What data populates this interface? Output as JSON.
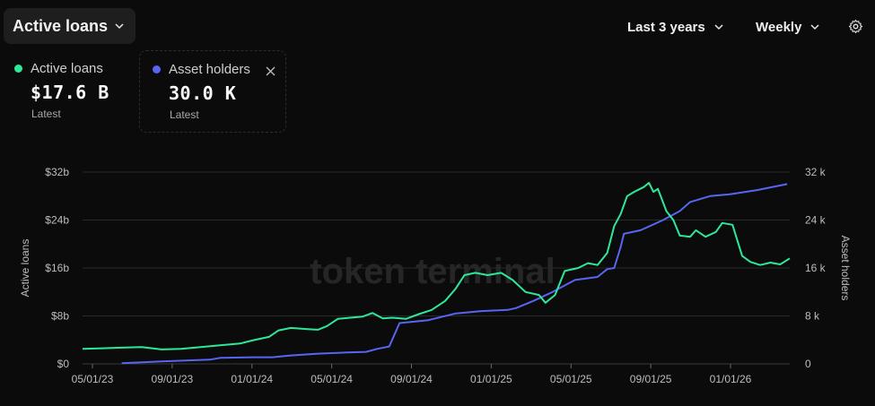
{
  "header": {
    "metric_label": "Active loans",
    "range_label": "Last 3 years",
    "interval_label": "Weekly"
  },
  "legend": [
    {
      "name": "Active loans",
      "value": "$17.6 B",
      "sub": "Latest",
      "color": "#2ee89a"
    },
    {
      "name": "Asset holders",
      "value": "30.0 K",
      "sub": "Latest",
      "color": "#5865f2"
    }
  ],
  "watermark": "token terminal",
  "chart_data": {
    "type": "line",
    "x_tick_labels": [
      "05/01/23",
      "09/01/23",
      "01/01/24",
      "05/01/24",
      "09/01/24",
      "01/01/25",
      "05/01/25",
      "09/01/25",
      "01/01/26"
    ],
    "y_left": {
      "label": "Active loans",
      "ticks": [
        "$0",
        "$8b",
        "$16b",
        "$24b",
        "$32b"
      ],
      "range": [
        0,
        32
      ]
    },
    "y_right": {
      "label": "Asset holders",
      "ticks": [
        "0",
        "8 k",
        "16 k",
        "24 k",
        "32 k"
      ],
      "range": [
        0,
        32
      ]
    },
    "grid": true,
    "series": [
      {
        "name": "Active loans",
        "axis": "left",
        "unit": "billion USD",
        "color": "#2ee89a",
        "points": [
          [
            "2023-05-01",
            2.5
          ],
          [
            "2023-06-01",
            2.6
          ],
          [
            "2023-07-01",
            2.7
          ],
          [
            "2023-08-01",
            2.8
          ],
          [
            "2023-09-01",
            2.4
          ],
          [
            "2023-10-01",
            2.5
          ],
          [
            "2023-11-01",
            2.8
          ],
          [
            "2023-12-01",
            3.1
          ],
          [
            "2024-01-01",
            3.4
          ],
          [
            "2024-01-20",
            3.9
          ],
          [
            "2024-02-15",
            4.5
          ],
          [
            "2024-03-01",
            5.6
          ],
          [
            "2024-03-20",
            6.0
          ],
          [
            "2024-04-15",
            5.8
          ],
          [
            "2024-05-01",
            5.7
          ],
          [
            "2024-05-15",
            6.3
          ],
          [
            "2024-06-01",
            7.5
          ],
          [
            "2024-06-20",
            7.7
          ],
          [
            "2024-07-10",
            7.9
          ],
          [
            "2024-07-25",
            8.5
          ],
          [
            "2024-08-10",
            7.6
          ],
          [
            "2024-08-25",
            7.7
          ],
          [
            "2024-09-15",
            7.5
          ],
          [
            "2024-10-05",
            8.3
          ],
          [
            "2024-10-25",
            9.0
          ],
          [
            "2024-11-15",
            10.5
          ],
          [
            "2024-12-01",
            12.5
          ],
          [
            "2024-12-15",
            14.8
          ],
          [
            "2025-01-01",
            15.2
          ],
          [
            "2025-01-20",
            14.8
          ],
          [
            "2025-02-10",
            15.2
          ],
          [
            "2025-02-28",
            14.0
          ],
          [
            "2025-03-20",
            12.0
          ],
          [
            "2025-04-10",
            11.5
          ],
          [
            "2025-04-20",
            10.2
          ],
          [
            "2025-05-05",
            11.5
          ],
          [
            "2025-05-20",
            15.5
          ],
          [
            "2025-06-10",
            16.0
          ],
          [
            "2025-06-25",
            16.8
          ],
          [
            "2025-07-10",
            16.5
          ],
          [
            "2025-07-25",
            18.5
          ],
          [
            "2025-08-05",
            23.0
          ],
          [
            "2025-08-15",
            25.0
          ],
          [
            "2025-08-25",
            28.0
          ],
          [
            "2025-09-05",
            28.7
          ],
          [
            "2025-09-20",
            29.5
          ],
          [
            "2025-09-28",
            30.2
          ],
          [
            "2025-10-05",
            28.7
          ],
          [
            "2025-10-12",
            29.2
          ],
          [
            "2025-10-25",
            25.5
          ],
          [
            "2025-11-05",
            24.0
          ],
          [
            "2025-11-15",
            21.4
          ],
          [
            "2025-12-01",
            21.2
          ],
          [
            "2025-12-10",
            22.3
          ],
          [
            "2025-12-25",
            21.2
          ],
          [
            "2026-01-10",
            22.0
          ],
          [
            "2026-01-20",
            23.5
          ],
          [
            "2026-02-05",
            23.2
          ],
          [
            "2026-02-20",
            18.0
          ],
          [
            "2026-03-05",
            17.0
          ],
          [
            "2026-03-20",
            16.5
          ],
          [
            "2026-04-05",
            16.9
          ],
          [
            "2026-04-20",
            16.6
          ],
          [
            "2026-05-05",
            17.6
          ]
        ]
      },
      {
        "name": "Asset holders",
        "axis": "right",
        "unit": "thousand",
        "color": "#5865f2",
        "points": [
          [
            "2023-07-01",
            0.1
          ],
          [
            "2023-09-01",
            0.4
          ],
          [
            "2023-11-15",
            0.7
          ],
          [
            "2023-12-01",
            1.0
          ],
          [
            "2024-01-20",
            1.1
          ],
          [
            "2024-02-20",
            1.1
          ],
          [
            "2024-03-20",
            1.4
          ],
          [
            "2024-05-01",
            1.7
          ],
          [
            "2024-06-15",
            1.9
          ],
          [
            "2024-07-15",
            2.0
          ],
          [
            "2024-08-01",
            2.5
          ],
          [
            "2024-08-20",
            2.9
          ],
          [
            "2024-09-05",
            6.8
          ],
          [
            "2024-10-20",
            7.3
          ],
          [
            "2024-12-01",
            8.4
          ],
          [
            "2025-01-10",
            8.8
          ],
          [
            "2025-02-20",
            9.0
          ],
          [
            "2025-03-05",
            9.3
          ],
          [
            "2025-04-01",
            10.5
          ],
          [
            "2025-05-01",
            12.0
          ],
          [
            "2025-06-05",
            14.0
          ],
          [
            "2025-07-10",
            14.5
          ],
          [
            "2025-07-25",
            15.8
          ],
          [
            "2025-08-05",
            16.0
          ],
          [
            "2025-08-15",
            19.5
          ],
          [
            "2025-08-20",
            21.7
          ],
          [
            "2025-09-15",
            22.3
          ],
          [
            "2025-10-20",
            24.0
          ],
          [
            "2025-11-15",
            25.5
          ],
          [
            "2025-12-01",
            27.0
          ],
          [
            "2026-01-01",
            28.0
          ],
          [
            "2026-02-01",
            28.3
          ],
          [
            "2026-03-15",
            29.0
          ],
          [
            "2026-05-01",
            30.0
          ]
        ]
      }
    ]
  }
}
